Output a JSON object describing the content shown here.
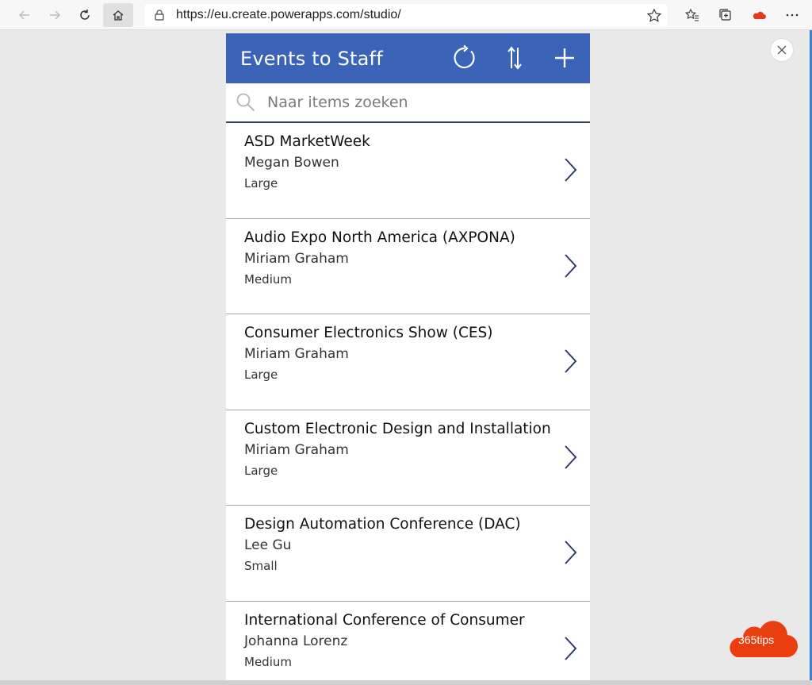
{
  "browser": {
    "url": "https://eu.create.powerapps.com/studio/"
  },
  "app": {
    "title": "Events to Staff",
    "search_placeholder": "Naar items zoeken",
    "items": [
      {
        "title": "ASD MarketWeek",
        "subtitle": "Megan Bowen",
        "body": "Large"
      },
      {
        "title": "Audio Expo North America (AXPONA)",
        "subtitle": "Miriam Graham",
        "body": "Medium"
      },
      {
        "title": "Consumer Electronics Show (CES)",
        "subtitle": "Miriam Graham",
        "body": "Large"
      },
      {
        "title": "Custom Electronic Design and Installation",
        "subtitle": "Miriam Graham",
        "body": "Large"
      },
      {
        "title": "Design Automation Conference (DAC)",
        "subtitle": "Lee Gu",
        "body": "Small"
      },
      {
        "title": "International Conference of Consumer",
        "subtitle": "Johanna Lorenz",
        "body": "Medium"
      }
    ]
  },
  "watermark": {
    "text": "365tips"
  },
  "colors": {
    "header": "#3b63b8",
    "accent": "#32405f",
    "logo": "#ea3e0f"
  },
  "icons": [
    "back-icon",
    "forward-icon",
    "refresh-icon",
    "home-icon",
    "lock-icon",
    "star-icon",
    "favorites-icon",
    "collections-icon",
    "onedrive-icon",
    "more-icon",
    "reload-icon",
    "sort-icon",
    "add-icon",
    "search-icon",
    "chevron-right-icon",
    "close-icon"
  ]
}
